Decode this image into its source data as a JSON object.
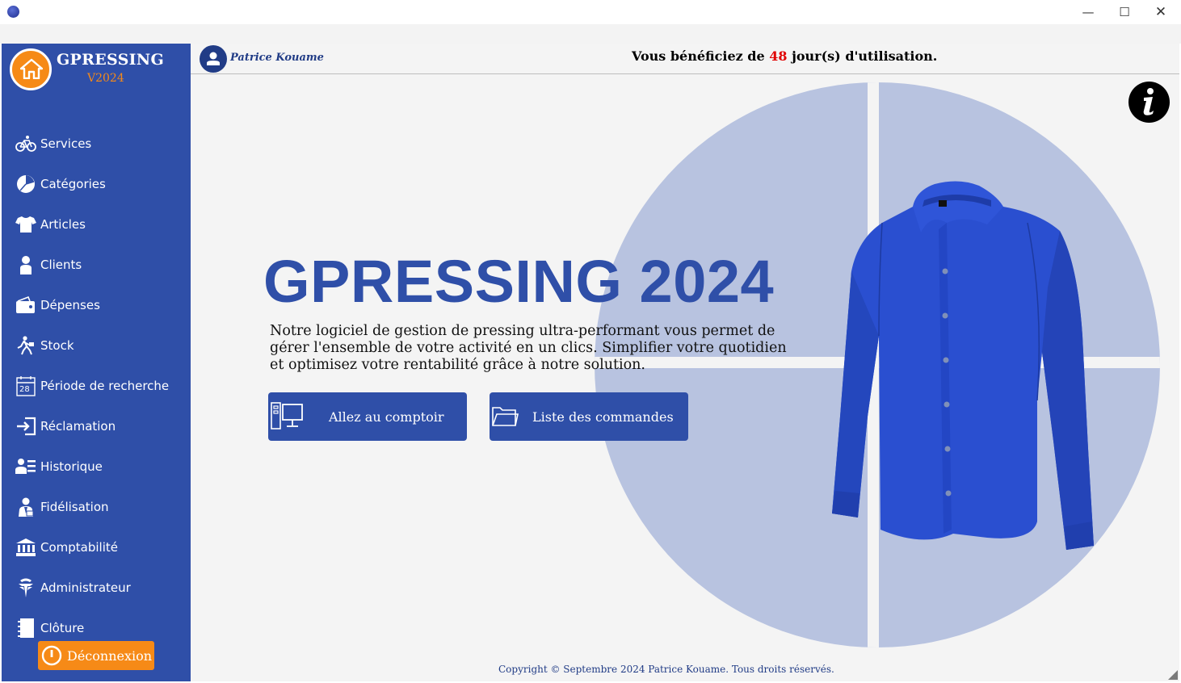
{
  "window": {
    "min_glyph": "—",
    "max_glyph": "☐",
    "close_glyph": "✕"
  },
  "sidebar": {
    "brand": "GPRESSING",
    "version": "V2024",
    "items": [
      {
        "label": "Services",
        "icon": "bicycle-icon"
      },
      {
        "label": "Catégories",
        "icon": "pie-chart-icon"
      },
      {
        "label": "Articles",
        "icon": "tshirt-icon"
      },
      {
        "label": "Clients",
        "icon": "person-icon"
      },
      {
        "label": "Dépenses",
        "icon": "wallet-icon"
      },
      {
        "label": "Stock",
        "icon": "worker-icon"
      },
      {
        "label": "Période de recherche",
        "icon": "calendar-icon"
      },
      {
        "label": "Réclamation",
        "icon": "sign-in-icon"
      },
      {
        "label": "Historique",
        "icon": "user-list-icon"
      },
      {
        "label": "Fidélisation",
        "icon": "lawyer-icon"
      },
      {
        "label": "Comptabilité",
        "icon": "bank-icon"
      },
      {
        "label": "Administrateur",
        "icon": "admin-icon"
      },
      {
        "label": "Clôture",
        "icon": "notebook-icon"
      }
    ],
    "calendar_day": "28",
    "logout_label": "Déconnexion"
  },
  "header": {
    "user_name": "Patrice Kouame",
    "usage_prefix": "Vous bénéficiez de ",
    "usage_days": "48",
    "usage_suffix": " jour(s) d'utilisation."
  },
  "hero": {
    "title": "GPRESSING 2024",
    "description": "Notre logiciel de gestion de pressing ultra-performant vous permet de gérer l'ensemble de votre activité en un clics. Simplifier votre quotidien et optimisez votre rentabilité grâce à notre solution.",
    "btn_comptoir": "Allez au comptoir",
    "btn_commandes": "Liste des commandes"
  },
  "footer": {
    "copyright": "Copyright © Septembre 2024 Patrice Kouame. Tous droits réservés."
  },
  "colors": {
    "sidebar": "#2f4fa8",
    "accent_orange": "#f68a17",
    "dark_blue": "#213c86",
    "days_red": "#e00000",
    "hero_circle": "#b8c3e0"
  }
}
